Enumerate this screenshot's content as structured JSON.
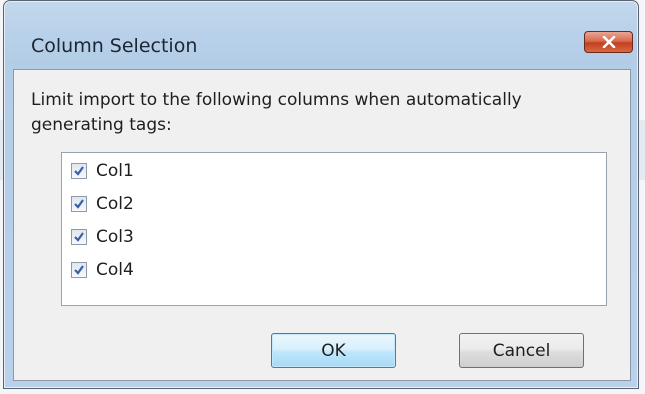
{
  "window": {
    "title": "Column Selection",
    "close_icon": "close-x-icon"
  },
  "dialog": {
    "instruction_line1": "Limit import to the following columns when automatically",
    "instruction_line2": "generating tags:",
    "columns": [
      {
        "label": "Col1",
        "checked": true
      },
      {
        "label": "Col2",
        "checked": true
      },
      {
        "label": "Col3",
        "checked": true
      },
      {
        "label": "Col4",
        "checked": true
      }
    ],
    "ok_label": "OK",
    "cancel_label": "Cancel"
  },
  "colors": {
    "accent_check": "#3a5fa8",
    "close_button": "#c7472a"
  }
}
